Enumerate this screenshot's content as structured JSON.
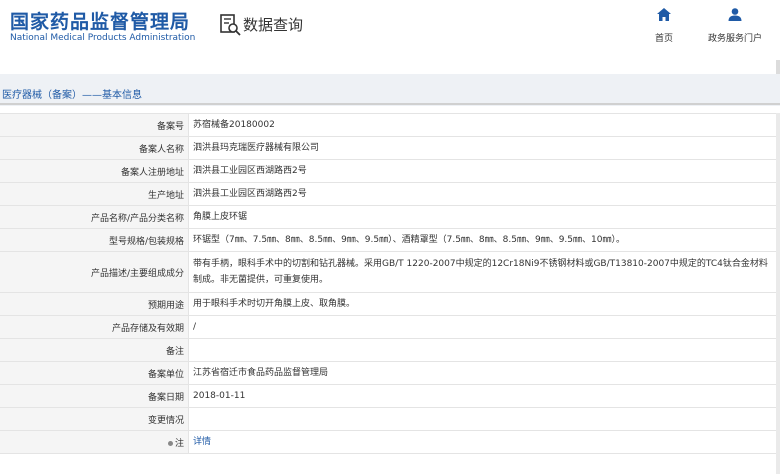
{
  "header": {
    "org_cn": "国家药品监督管理局",
    "org_en": "National Medical Products Administration",
    "query_title": "数据查询",
    "nav": [
      {
        "label": "首页",
        "icon": "home-icon"
      },
      {
        "label": "政务服务门户",
        "icon": "user-icon"
      }
    ]
  },
  "breadcrumb": "医疗器械（备案）——基本信息",
  "colors": {
    "brand": "#1f5aa6",
    "label_bg": "#f5f5f5"
  },
  "rows": [
    {
      "label": "备案号",
      "value": "苏宿械备20180002"
    },
    {
      "label": "备案人名称",
      "value": "泗洪县玛克瑞医疗器械有限公司"
    },
    {
      "label": "备案人注册地址",
      "value": "泗洪县工业园区西湖路西2号"
    },
    {
      "label": "生产地址",
      "value": "泗洪县工业园区西湖路西2号"
    },
    {
      "label": "产品名称/产品分类名称",
      "value": "角膜上皮环锯"
    },
    {
      "label": "型号规格/包装规格",
      "value": "环锯型（7㎜、7.5㎜、8㎜、8.5㎜、9㎜、9.5㎜）、酒精罩型（7.5㎜、8㎜、8.5㎜、9㎜、9.5㎜、10㎜）。"
    },
    {
      "label": "产品描述/主要组成成分",
      "value": "带有手柄，眼科手术中的切割和钻孔器械。采用GB/T 1220-2007中规定的12Cr18Ni9不锈钢材料或GB/T13810-2007中规定的TC4钛合金材料制成。非无菌提供，可重复使用。"
    },
    {
      "label": "预期用途",
      "value": "用于眼科手术时切开角膜上皮、取角膜。"
    },
    {
      "label": "产品存储及有效期",
      "value": "/"
    },
    {
      "label": "备注",
      "value": ""
    },
    {
      "label": "备案单位",
      "value": "江苏省宿迁市食品药品监督管理局"
    },
    {
      "label": "备案日期",
      "value": "2018-01-11"
    },
    {
      "label": "变更情况",
      "value": ""
    },
    {
      "label": "注",
      "value": "详情"
    }
  ]
}
